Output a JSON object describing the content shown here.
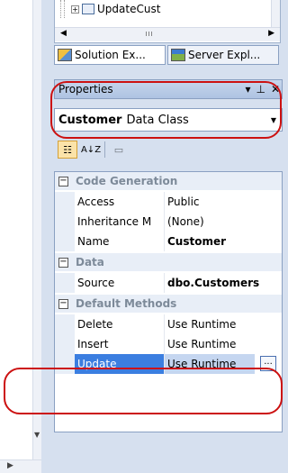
{
  "tree": {
    "item_label": "UpdateCust",
    "scroll_grip": "III"
  },
  "tabs": [
    {
      "label": "Solution Ex...",
      "icon": "solution-explorer-icon"
    },
    {
      "label": "Server Expl...",
      "icon": "server-explorer-icon"
    }
  ],
  "properties": {
    "title": "Properties",
    "object_name": "Customer",
    "object_type": "Data Class",
    "toolbar": {
      "categorized_icon": "categorized-icon",
      "alphabetical_label": "A↓Z",
      "property_pages_icon": "property-pages-icon"
    },
    "categories": [
      {
        "name": "Code Generation",
        "rows": [
          {
            "name": "Access",
            "value": "Public",
            "bold": false
          },
          {
            "name": "Inheritance M",
            "value": "(None)",
            "bold": false
          },
          {
            "name": "Name",
            "value": "Customer",
            "bold": true
          }
        ]
      },
      {
        "name": "Data",
        "rows": [
          {
            "name": "Source",
            "value": "dbo.Customers",
            "bold": true
          }
        ]
      },
      {
        "name": "Default Methods",
        "rows": [
          {
            "name": "Delete",
            "value": "Use Runtime",
            "bold": false
          },
          {
            "name": "Insert",
            "value": "Use Runtime",
            "bold": false
          },
          {
            "name": "Update",
            "value": "Use Runtime",
            "bold": false,
            "selected": true
          }
        ]
      }
    ],
    "ellipsis_label": "..."
  },
  "accent_colors": {
    "selection": "#3b7ee0",
    "annotation": "#cc1111"
  }
}
